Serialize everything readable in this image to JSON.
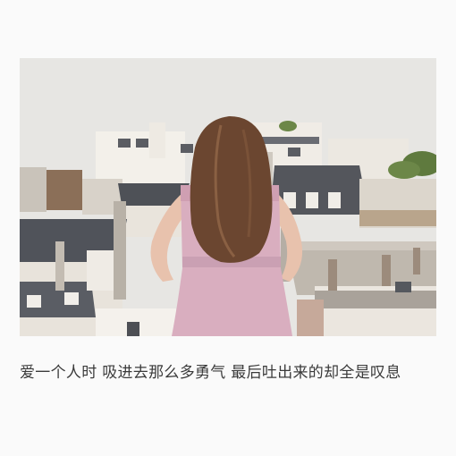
{
  "photo": {
    "subject": "woman-facing-rooftops",
    "colors": {
      "sky": "#e7e6e3",
      "dress": "#d9aebf",
      "hair": "#6b4630",
      "roof_dark": "#4f5158",
      "wall_light": "#f1eee9"
    }
  },
  "caption": {
    "text": "爱一个人时 吸进去那么多勇气 最后吐出来的却全是叹息"
  }
}
